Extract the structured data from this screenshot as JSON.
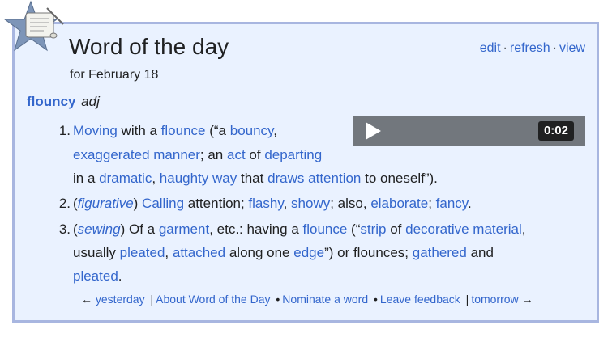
{
  "header": {
    "title": "Word of the day",
    "date": "for February 18",
    "actions": [
      "edit",
      "refresh",
      "view"
    ],
    "action_sep": "·"
  },
  "headword": {
    "word": "flouncy",
    "pos": "adj"
  },
  "audio": {
    "duration": "0:02"
  },
  "definitions": [
    {
      "num": "1.",
      "line1": [
        {
          "t": "Moving",
          "link": true
        },
        {
          "t": " with a ",
          "link": false
        },
        {
          "t": "flounce",
          "link": true
        },
        {
          "t": " (“a ",
          "link": false
        },
        {
          "t": "bouncy",
          "link": true
        },
        {
          "t": ",",
          "link": false
        }
      ],
      "line2": [
        {
          "t": "exaggerated",
          "link": true
        },
        {
          "t": " ",
          "link": false
        },
        {
          "t": "manner",
          "link": true
        },
        {
          "t": "; an ",
          "link": false
        },
        {
          "t": "act",
          "link": true
        },
        {
          "t": " of ",
          "link": false
        },
        {
          "t": "departing",
          "link": true
        }
      ],
      "line3": [
        {
          "t": "in a ",
          "link": false
        },
        {
          "t": "dramatic",
          "link": true
        },
        {
          "t": ", ",
          "link": false
        },
        {
          "t": "haughty",
          "link": true
        },
        {
          "t": " ",
          "link": false
        },
        {
          "t": "way",
          "link": true
        },
        {
          "t": " that ",
          "link": false
        },
        {
          "t": "draws",
          "link": true
        },
        {
          "t": " ",
          "link": false
        },
        {
          "t": "attention",
          "link": true
        },
        {
          "t": " to oneself”).",
          "link": false
        }
      ]
    },
    {
      "num": "2.",
      "line1": [
        {
          "t": "(",
          "link": false
        },
        {
          "t": "figurative",
          "link": true,
          "italic": true
        },
        {
          "t": ") ",
          "link": false
        },
        {
          "t": "Calling",
          "link": true
        },
        {
          "t": " attention; ",
          "link": false
        },
        {
          "t": "flashy",
          "link": true
        },
        {
          "t": ", ",
          "link": false
        },
        {
          "t": "showy",
          "link": true
        },
        {
          "t": "; also, ",
          "link": false
        },
        {
          "t": "elaborate",
          "link": true
        },
        {
          "t": "; ",
          "link": false
        },
        {
          "t": "fancy",
          "link": true
        },
        {
          "t": ".",
          "link": false
        }
      ]
    },
    {
      "num": "3.",
      "line1": [
        {
          "t": "(",
          "link": false
        },
        {
          "t": "sewing",
          "link": true,
          "italic": true
        },
        {
          "t": ") Of a ",
          "link": false
        },
        {
          "t": "garment",
          "link": true
        },
        {
          "t": ", etc.: having a ",
          "link": false
        },
        {
          "t": "flounce",
          "link": true
        },
        {
          "t": " (“",
          "link": false
        },
        {
          "t": "strip",
          "link": true
        },
        {
          "t": " of ",
          "link": false
        },
        {
          "t": "decorative",
          "link": true
        },
        {
          "t": " ",
          "link": false
        },
        {
          "t": "material",
          "link": true
        },
        {
          "t": ",",
          "link": false
        }
      ],
      "line2": [
        {
          "t": "usually ",
          "link": false
        },
        {
          "t": "pleated",
          "link": true
        },
        {
          "t": ", ",
          "link": false
        },
        {
          "t": "attached",
          "link": true
        },
        {
          "t": " along one ",
          "link": false
        },
        {
          "t": "edge",
          "link": true
        },
        {
          "t": "”) or flounces; ",
          "link": false
        },
        {
          "t": "gathered",
          "link": true
        },
        {
          "t": " and",
          "link": false
        }
      ],
      "line3": [
        {
          "t": "pleated",
          "link": true
        },
        {
          "t": ".",
          "link": false
        }
      ]
    }
  ],
  "footer": {
    "prev_arrow": "←",
    "prev": "yesterday",
    "bar": "|",
    "about": "About Word of the Day",
    "bullet": "•",
    "nominate": "Nominate a word",
    "feedback": "Leave feedback",
    "next": "tomorrow",
    "next_arrow": "→"
  },
  "colors": {
    "link": "#3366cc",
    "box_bg": "#eaf2ff",
    "box_border": "#a8b6e0",
    "audio_bg": "#72777d"
  }
}
